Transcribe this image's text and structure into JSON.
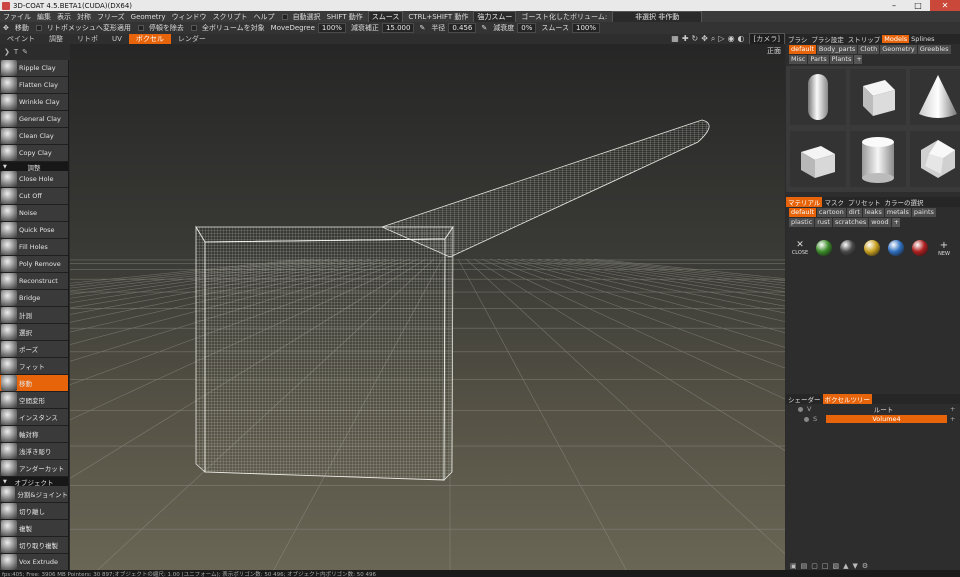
{
  "window": {
    "title": "3D-COAT 4.5.BETA1(CUDA)(DX64)"
  },
  "menu": {
    "items": [
      "ファイル",
      "編集",
      "表示",
      "対称",
      "フリーズ",
      "Geometry",
      "ウィンドウ",
      "スクリプト",
      "ヘルプ"
    ],
    "auto_select": "自動選択",
    "shift_action": "SHIFT 動作",
    "smooth_dropdown": "スムース",
    "ctrl_shift_action": "CTRL+SHIFT 動作",
    "strong_smooth_dropdown": "強力スムー",
    "ghost_label": "ゴースト化したボリューム:",
    "ghost_dropdown": "非選択 非作動"
  },
  "toolbar": {
    "move": "移動",
    "retopo_mesh": "リトポメッシュへ変形適用",
    "stop": "停頓を除去",
    "all_volumes": "全ボリュームを対象",
    "move_degree_label": "MoveDegree",
    "move_degree_value": "100%",
    "falloff_label": "減衰補正",
    "falloff_value": "15.000",
    "radius_label": "半径",
    "radius_value": "0.456",
    "depth_label": "減衰度",
    "depth_value": "0%",
    "smooth_label": "スムース",
    "smooth_value": "100%"
  },
  "rooms": {
    "tabs": [
      "ペイント",
      "調整",
      "リトポ",
      "UV",
      "ボクセル",
      "レンダー"
    ],
    "active": "ボクセル",
    "camera": "[カメラ]"
  },
  "viewport": {
    "view_label": "正面"
  },
  "tools": [
    {
      "type": "tool",
      "label": "Ripple Clay"
    },
    {
      "type": "tool",
      "label": "Flatten Clay"
    },
    {
      "type": "tool",
      "label": "Wrinkle Clay"
    },
    {
      "type": "tool",
      "label": "General Clay"
    },
    {
      "type": "tool",
      "label": "Clean Clay"
    },
    {
      "type": "tool",
      "label": "Copy Clay"
    },
    {
      "type": "section",
      "label": "調整"
    },
    {
      "type": "tool",
      "label": "Close Hole"
    },
    {
      "type": "tool",
      "label": "Cut Off"
    },
    {
      "type": "tool",
      "label": "Noise"
    },
    {
      "type": "tool",
      "label": "Quick Pose"
    },
    {
      "type": "tool",
      "label": "Fill Holes"
    },
    {
      "type": "tool",
      "label": "Poly Remove"
    },
    {
      "type": "tool",
      "label": "Reconstruct"
    },
    {
      "type": "tool",
      "label": "Bridge"
    },
    {
      "type": "tool",
      "label": "計測"
    },
    {
      "type": "tool",
      "label": "選択"
    },
    {
      "type": "tool",
      "label": "ポーズ"
    },
    {
      "type": "tool",
      "label": "フィット"
    },
    {
      "type": "tool",
      "label": "移動",
      "active": true
    },
    {
      "type": "tool",
      "label": "空間変形"
    },
    {
      "type": "tool",
      "label": "インスタンス"
    },
    {
      "type": "tool",
      "label": "軸対称"
    },
    {
      "type": "tool",
      "label": "浅浮き彫り"
    },
    {
      "type": "tool",
      "label": "アンダーカット"
    },
    {
      "type": "section",
      "label": "オブジェクト"
    },
    {
      "type": "tool",
      "label": "分割&ジョイント"
    },
    {
      "type": "tool",
      "label": "切り離し"
    },
    {
      "type": "tool",
      "label": "複製"
    },
    {
      "type": "tool",
      "label": "切り取り複製"
    },
    {
      "type": "tool",
      "label": "Vox Extrude"
    }
  ],
  "right_panel": {
    "top_tabs": [
      "ブラシ",
      "ブラシ設定",
      "ストリップ",
      "Models",
      "Splines"
    ],
    "top_active": "Models",
    "model_categories": [
      "default",
      "Body_parts",
      "Cloth",
      "Geometry",
      "Greebles",
      "Misc",
      "Parts",
      "Plants"
    ],
    "model_active": "default",
    "models": [
      "capsule",
      "cube",
      "cone",
      "rounded-cube",
      "cylinder",
      "dodecahedron"
    ],
    "material_tabs": [
      "マテリアル",
      "マスク",
      "プリセット",
      "カラーの選択"
    ],
    "material_active": "マテリアル",
    "material_categories": [
      "default",
      "cartoon",
      "dirt",
      "leaks",
      "metals",
      "paints",
      "plastic",
      "rust",
      "scratches",
      "wood"
    ],
    "material_cat_active": "default",
    "close_label": "CLOSE",
    "new_label": "NEW",
    "material_colors": [
      "#3c8c2a",
      "#4a4a4a",
      "#c8a020",
      "#3070c0",
      "#b02020"
    ],
    "layer_tabs": [
      "シェーダー",
      "ボクセルツリー"
    ],
    "layer_active": "ボクセルツリー",
    "layers": [
      {
        "flag": "V",
        "name": "ルート",
        "selected": false
      },
      {
        "flag": "S",
        "name": "Volume4",
        "selected": true
      }
    ]
  },
  "status": {
    "text": "fps:405; Free: 3906 MB Pointers: 30 897;オブジェクトの縮尺: 1.00 (ユニフォーム); 表示ポリゴン数: 50 496; オブジェクト内ポリゴン数: 50 496"
  }
}
